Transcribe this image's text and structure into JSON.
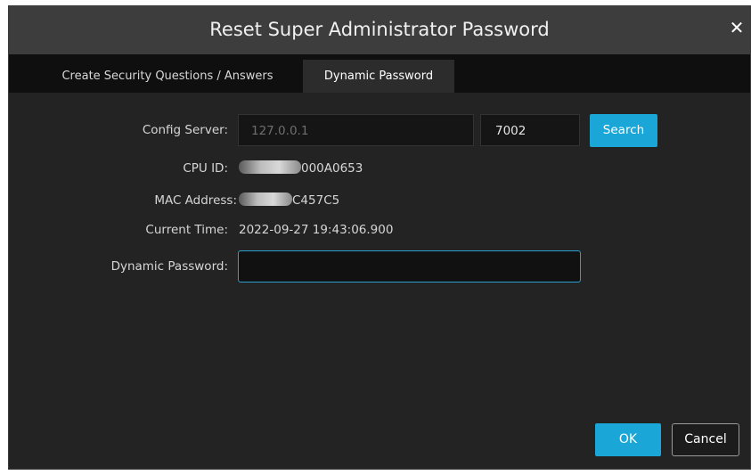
{
  "dialog": {
    "title": "Reset Super Administrator Password",
    "close_icon": "close-icon"
  },
  "tabs": [
    {
      "label": "Create Security Questions / Answers",
      "active": false
    },
    {
      "label": "Dynamic Password",
      "active": true
    }
  ],
  "form": {
    "config_server_label": "Config Server:",
    "config_server_ip": "127.0.0.1",
    "config_server_port": "7002",
    "search_label": "Search",
    "cpu_id_label": "CPU ID:",
    "cpu_id_value": "000A0653",
    "mac_address_label": "MAC Address:",
    "mac_address_value": "C457C5",
    "current_time_label": "Current Time:",
    "current_time_value": "2022-09-27 19:43:06.900",
    "dynamic_password_label": "Dynamic Password:",
    "dynamic_password_value": ""
  },
  "buttons": {
    "ok": "OK",
    "cancel": "Cancel"
  },
  "colors": {
    "accent": "#1aa7d8",
    "background": "#232323",
    "titlebar": "#3d3d3d"
  }
}
